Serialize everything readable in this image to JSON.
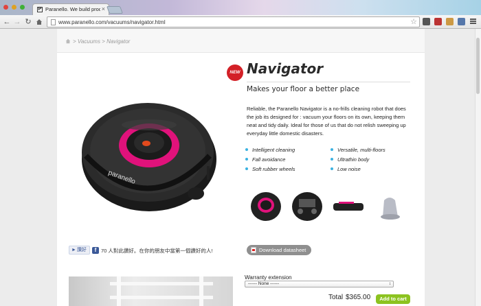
{
  "browser": {
    "tab_title": "Paranello. We build products",
    "tab_favicon": "P",
    "tab_close": "×",
    "url": "www.paranello.com/vacuums/navigator.html",
    "traffic_lights": [
      "#e0443e",
      "#dea123",
      "#3fb037"
    ]
  },
  "breadcrumb": {
    "text": "> Vacuums > Navigator"
  },
  "product": {
    "badge": "NEW",
    "title": "Navigator",
    "subtitle": "Makes your floor a better place",
    "description": "Reliable, the Paranello Navigator is a no-frills cleaning robot that does the job its designed for : vacuum your floors on its own, keeping them neat and tidy daily. Ideal for those of us that do not relish sweeping up everyday little domestic disasters.",
    "features_left": [
      "Intelligent cleaning",
      "Fall avoidance",
      "Soft rubber wheels"
    ],
    "features_right": [
      "Versatile, multi-floors",
      "Ultrathin body",
      "Low noise"
    ],
    "robot_label": "paranello",
    "accent_color": "#e0127b"
  },
  "social": {
    "like_label": "讚好",
    "like_text": "70 人對此讚好。在你的朋友中當第一個讚好的人!"
  },
  "download": {
    "label": "Download datasheet"
  },
  "purchase": {
    "warranty_label": "Warranty extension",
    "warranty_selected": "------ None ------",
    "total_label": "Total",
    "total_value": "$365.00",
    "add_to_cart": "Add to cart"
  }
}
